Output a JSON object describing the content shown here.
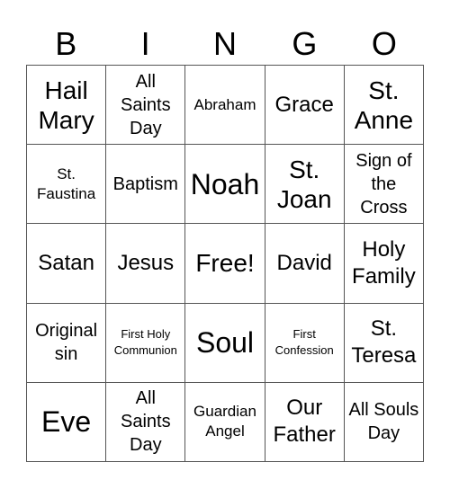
{
  "header": [
    "B",
    "I",
    "N",
    "G",
    "O"
  ],
  "cells": [
    {
      "text": "Hail Mary",
      "size": "l"
    },
    {
      "text": "All Saints Day",
      "size": "n"
    },
    {
      "text": "Abraham",
      "size": "s"
    },
    {
      "text": "Grace",
      "size": "m"
    },
    {
      "text": "St. Anne",
      "size": "l"
    },
    {
      "text": "St. Faustina",
      "size": "s"
    },
    {
      "text": "Baptism",
      "size": "n"
    },
    {
      "text": "Noah",
      "size": "xl"
    },
    {
      "text": "St. Joan",
      "size": "l"
    },
    {
      "text": "Sign of the Cross",
      "size": "n"
    },
    {
      "text": "Satan",
      "size": "m"
    },
    {
      "text": "Jesus",
      "size": "m"
    },
    {
      "text": "Free!",
      "size": "l"
    },
    {
      "text": "David",
      "size": "m"
    },
    {
      "text": "Holy Family",
      "size": "m"
    },
    {
      "text": "Original sin",
      "size": "n"
    },
    {
      "text": "First Holy Communion",
      "size": "xs"
    },
    {
      "text": "Soul",
      "size": "xl"
    },
    {
      "text": "First Confession",
      "size": "xs"
    },
    {
      "text": "St. Teresa",
      "size": "m"
    },
    {
      "text": "Eve",
      "size": "xl"
    },
    {
      "text": "All Saints Day",
      "size": "n"
    },
    {
      "text": "Guardian Angel",
      "size": "s"
    },
    {
      "text": "Our Father",
      "size": "m"
    },
    {
      "text": "All Souls Day",
      "size": "n"
    }
  ]
}
